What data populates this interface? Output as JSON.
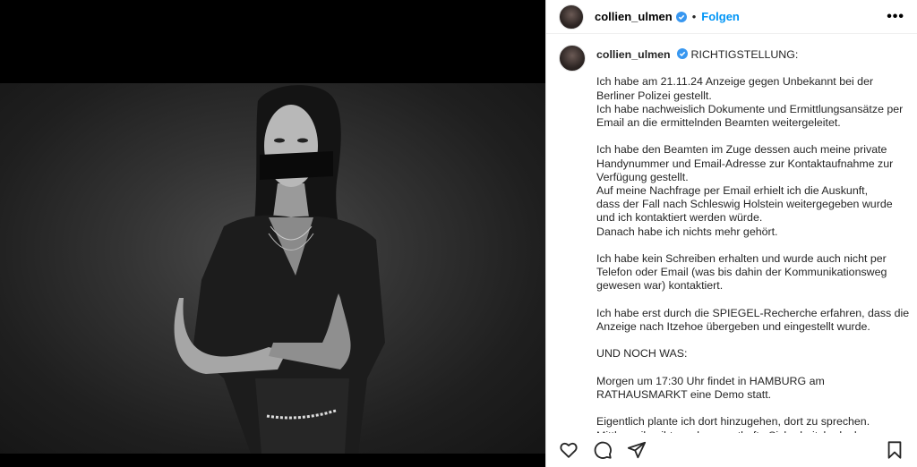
{
  "post": {
    "username": "collien_ulmen",
    "follow_label": "Folgen",
    "dot": "•",
    "more_label": "•••"
  },
  "caption": {
    "username": "collien_ulmen",
    "title": "RICHTIGSTELLUNG:",
    "paragraphs": [
      [
        "Ich habe am 21.11.24 Anzeige gegen Unbekannt bei der",
        "Berliner Polizei gestellt.",
        "Ich habe nachweislich Dokumente und Ermittlungsansätze per",
        "Email an die ermittelnden Beamten weitergeleitet."
      ],
      [
        "Ich habe den Beamten im Zuge dessen auch meine private",
        "Handynummer und Email-Adresse zur Kontaktaufnahme zur",
        "Verfügung gestellt.",
        "Auf meine Nachfrage per Email erhielt ich die Auskunft,",
        "dass der Fall nach Schleswig Holstein weitergegeben wurde",
        "und ich kontaktiert werden würde.",
        "Danach habe ich nichts mehr gehört."
      ],
      [
        "Ich habe kein Schreiben erhalten und wurde auch nicht per",
        "Telefon oder Email (was bis dahin der Kommunikationsweg",
        "gewesen war) kontaktiert."
      ],
      [
        "Ich habe erst durch die SPIEGEL-Recherche erfahren, dass die",
        "Anzeige nach Itzehoe übergeben und eingestellt wurde."
      ],
      [
        "UND NOCH WAS:"
      ],
      [
        "Morgen um 17:30 Uhr findet in HAMBURG am",
        "RATHAUSMARKT eine Demo statt."
      ],
      [
        "Eigentlich plante ich dort hinzugehen, dort zu sprechen.",
        "Mittlerweile gibt es aber ernsthafte Sicherheitsbedenken"
      ]
    ]
  },
  "actions": {
    "like_icon": "heart-icon",
    "comment_icon": "comment-icon",
    "share_icon": "share-icon",
    "save_icon": "bookmark-icon"
  },
  "colors": {
    "accent": "#0095f6",
    "verified": "#3897f0",
    "text": "#262626"
  }
}
